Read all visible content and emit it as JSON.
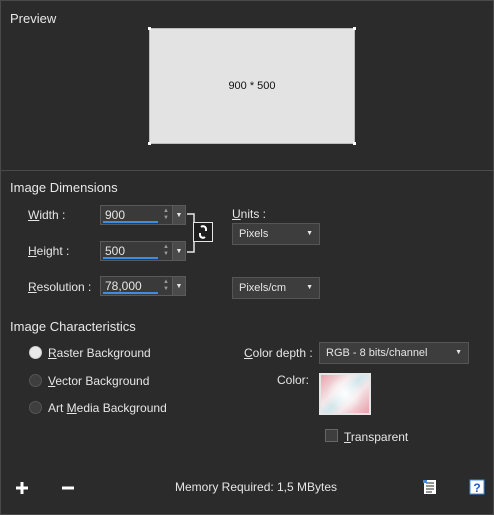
{
  "preview": {
    "title": "Preview",
    "dimensions_text": "900 * 500"
  },
  "image_dimensions": {
    "title": "Image Dimensions",
    "width": {
      "label_hotkey": "W",
      "label_rest": "idth :",
      "value": "900"
    },
    "height": {
      "label_hotkey": "H",
      "label_rest": "eight :",
      "value": "500"
    },
    "resolution": {
      "label_hotkey": "R",
      "label_rest": "esolution :",
      "value": "78,000"
    },
    "units": {
      "label_hotkey": "U",
      "label_rest": "nits :",
      "value": "Pixels"
    },
    "resolution_units": {
      "value": "Pixels/cm"
    }
  },
  "image_characteristics": {
    "title": "Image Characteristics",
    "raster": {
      "label_hotkey": "R",
      "label_rest": "aster Background",
      "selected": true
    },
    "vector": {
      "label_hotkey": "V",
      "label_rest": "ector Background",
      "selected": false
    },
    "art_media": {
      "label_pre": "Art ",
      "label_hotkey": "M",
      "label_rest": "edia Background",
      "selected": false
    },
    "color_depth": {
      "label_hotkey": "C",
      "label_rest": "olor depth :",
      "value": "RGB - 8 bits/channel"
    },
    "color": {
      "label": "Color:"
    },
    "transparent": {
      "label_hotkey": "T",
      "label_rest": "ransparent",
      "checked": false
    }
  },
  "footer": {
    "memory_label": "Memory Required:",
    "memory_value": "1,5 MBytes"
  },
  "colors": {
    "accent": "#3d8ee0",
    "background": "#2b2b2b"
  },
  "icons": [
    "plus-icon",
    "minus-icon",
    "link-icon",
    "preset-icon",
    "help-icon"
  ]
}
